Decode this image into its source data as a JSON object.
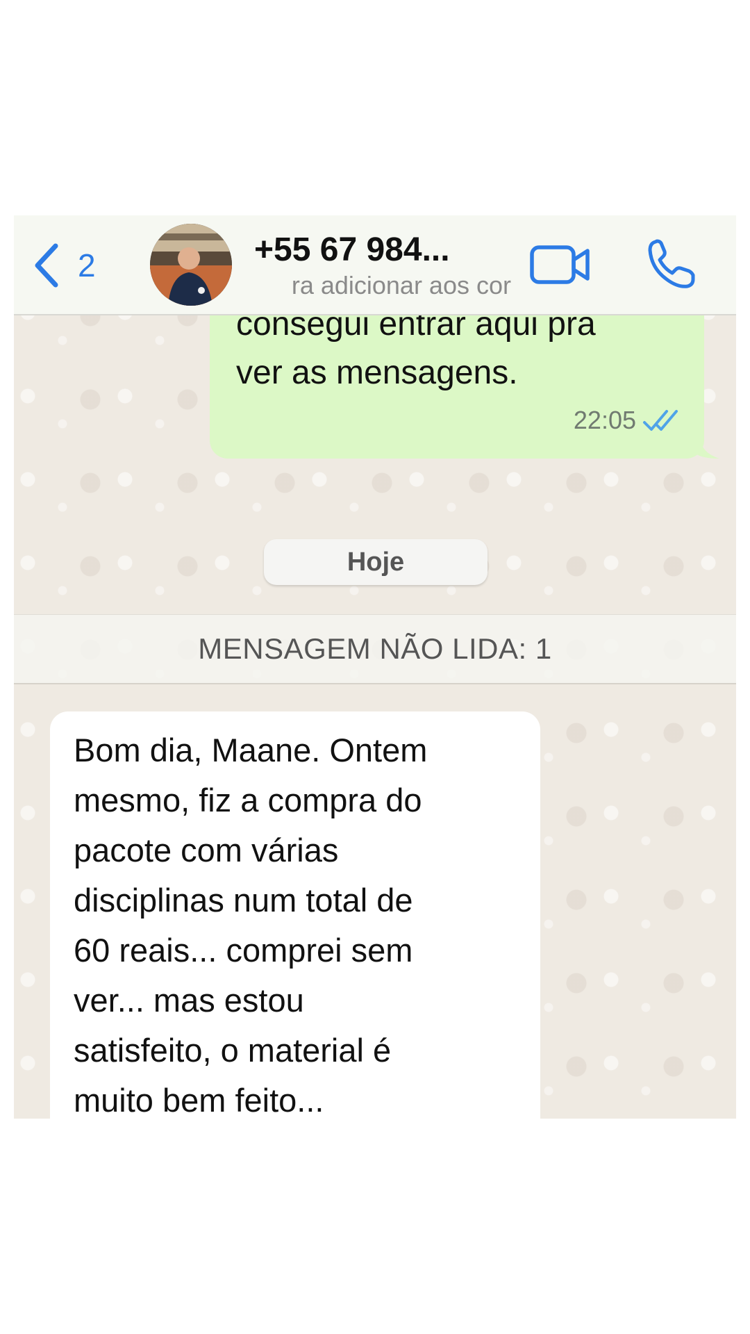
{
  "header": {
    "back_count": "2",
    "contact_name": "+55 67 984...",
    "contact_subtitle": "ra adicionar aos cor",
    "avatar": "contact-photo",
    "video_icon": "video-camera-icon",
    "phone_icon": "phone-icon",
    "back_icon": "chevron-left-icon"
  },
  "outgoing_message": {
    "text": "consegui entrar aqui pra\nver as mensagens.",
    "time": "22:05",
    "status_icon": "double-check-icon",
    "status_color": "#4fa3e8"
  },
  "date_divider": "Hoje",
  "unread_banner": "MENSAGEM NÃO LIDA: 1",
  "incoming_message": {
    "text": "Bom dia, Maane. Ontem\nmesmo, fiz a compra do\npacote com várias\ndisciplinas num total de\n60 reais... comprei sem\nver... mas estou\nsatisfeito, o material é\nmuito bem feito..."
  },
  "colors": {
    "accent": "#2c7be5",
    "outgoing_bubble": "#dcf8c6",
    "incoming_bubble": "#ffffff",
    "wallpaper": "#efeae2"
  }
}
